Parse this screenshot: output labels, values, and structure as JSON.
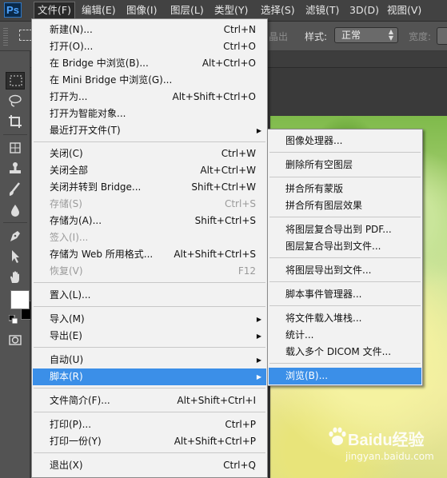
{
  "app": {
    "logo": "Ps"
  },
  "menubar": {
    "items": [
      "文件(F)",
      "编辑(E)",
      "图像(I)",
      "图层(L)",
      "类型(Y)",
      "选择(S)",
      "滤镜(T)",
      "3D(D)",
      "视图(V)"
    ],
    "active_index": 0
  },
  "options_bar": {
    "partial_label": "晶出",
    "style_label": "样式:",
    "style_value": "正常",
    "width_label": "宽度:"
  },
  "tools": {
    "icons": [
      "rect-marquee-icon",
      "lasso-icon",
      "crop-icon",
      "quick-selection-icon",
      "clone-stamp-icon",
      "brush-icon",
      "blur-icon",
      "pen-icon",
      "path-selection-icon",
      "hand-icon"
    ],
    "foreground_color": "#ffffff",
    "background_color": "#000000"
  },
  "file_menu": {
    "items": [
      {
        "label": "新建(N)...",
        "shortcut": "Ctrl+N"
      },
      {
        "label": "打开(O)...",
        "shortcut": "Ctrl+O"
      },
      {
        "label": "在 Bridge 中浏览(B)...",
        "shortcut": "Alt+Ctrl+O"
      },
      {
        "label": "在 Mini Bridge 中浏览(G)...",
        "shortcut": ""
      },
      {
        "label": "打开为...",
        "shortcut": "Alt+Shift+Ctrl+O"
      },
      {
        "label": "打开为智能对象...",
        "shortcut": ""
      },
      {
        "label": "最近打开文件(T)",
        "shortcut": ""
      },
      {
        "label": "关闭(C)",
        "shortcut": "Ctrl+W"
      },
      {
        "label": "关闭全部",
        "shortcut": "Alt+Ctrl+W"
      },
      {
        "label": "关闭并转到 Bridge...",
        "shortcut": "Shift+Ctrl+W"
      },
      {
        "label": "存储(S)",
        "shortcut": "Ctrl+S"
      },
      {
        "label": "存储为(A)...",
        "shortcut": "Shift+Ctrl+S"
      },
      {
        "label": "签入(I)...",
        "shortcut": ""
      },
      {
        "label": "存储为 Web 所用格式...",
        "shortcut": "Alt+Shift+Ctrl+S"
      },
      {
        "label": "恢复(V)",
        "shortcut": "F12"
      },
      {
        "label": "置入(L)...",
        "shortcut": ""
      },
      {
        "label": "导入(M)",
        "shortcut": ""
      },
      {
        "label": "导出(E)",
        "shortcut": ""
      },
      {
        "label": "自动(U)",
        "shortcut": ""
      },
      {
        "label": "脚本(R)",
        "shortcut": ""
      },
      {
        "label": "文件简介(F)...",
        "shortcut": "Alt+Shift+Ctrl+I"
      },
      {
        "label": "打印(P)...",
        "shortcut": "Ctrl+P"
      },
      {
        "label": "打印一份(Y)",
        "shortcut": "Alt+Shift+Ctrl+P"
      },
      {
        "label": "退出(X)",
        "shortcut": "Ctrl+Q"
      }
    ]
  },
  "script_submenu": {
    "items": [
      {
        "label": "图像处理器..."
      },
      {
        "label": "删除所有空图层"
      },
      {
        "label": "拼合所有蒙版"
      },
      {
        "label": "拼合所有图层效果"
      },
      {
        "label": "将图层复合导出到 PDF..."
      },
      {
        "label": "图层复合导出到文件..."
      },
      {
        "label": "将图层导出到文件..."
      },
      {
        "label": "脚本事件管理器..."
      },
      {
        "label": "将文件载入堆栈..."
      },
      {
        "label": "统计..."
      },
      {
        "label": "载入多个 DICOM 文件..."
      },
      {
        "label": "浏览(B)..."
      }
    ]
  },
  "watermark": {
    "main": "Baidu经验",
    "sub": "jingyan.baidu.com"
  }
}
